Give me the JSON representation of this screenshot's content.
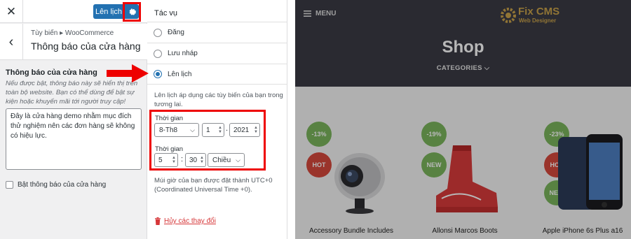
{
  "customizer": {
    "publish_label": "Lên lịch",
    "breadcrumb": "Tùy biến ▸ WooCommerce",
    "section_title": "Thông báo của cửa hàng",
    "control_label": "Thông báo của cửa hàng",
    "control_description": "Nếu được bật, thông báo này sẽ hiển thị trên toàn bộ website. Bạn có thể dùng để bật sự kiện hoặc khuyến mãi tới người truy cập!",
    "notice_text": "Đây là cửa hàng demo nhằm mục đích thử nghiệm nên các đơn hàng sẽ không có hiệu lực.",
    "checkbox_label": "Bật thông báo của cửa hàng"
  },
  "publish_settings": {
    "title": "Tác vụ",
    "options": [
      {
        "label": "Đăng",
        "selected": false
      },
      {
        "label": "Lưu nháp",
        "selected": false
      },
      {
        "label": "Lên lịch",
        "selected": true
      }
    ],
    "schedule_description": "Lên lịch áp dụng các tùy biến của bạn trong tương lai.",
    "date_label": "Thời gian",
    "month_value": "8-Th8",
    "day_value": "1",
    "year_value": "2021",
    "time_label": "Thời gian",
    "hour_value": "5",
    "minute_value": "30",
    "ampm_value": "Chiều",
    "timezone_note": "Múi giờ của bạn được đặt thành UTC+0 (Coordinated Universal Time +0).",
    "discard_label": "Hủy các thay đổi"
  },
  "preview": {
    "menu_label": "MENU",
    "logo_text": "Fix CMS",
    "logo_subtext": "Web Designer",
    "shop_title": "Shop",
    "categories_label": "CATEGORIES",
    "products": [
      {
        "name": "Accessory Bundle Includes",
        "badges": [
          "-13%",
          "HOT"
        ]
      },
      {
        "name": "Allonsi Marcos Boots",
        "badges": [
          "-19%",
          "NEW"
        ]
      },
      {
        "name": "Apple iPhone 6s Plus a16",
        "badges": [
          "-23%",
          "HOT",
          "NEW"
        ]
      }
    ]
  },
  "colors": {
    "wp_blue": "#2271b1",
    "highlight_red": "#e00000",
    "header_dark": "#3b3b45",
    "badge_green": "#7ab55c",
    "badge_red": "#d6483c"
  }
}
